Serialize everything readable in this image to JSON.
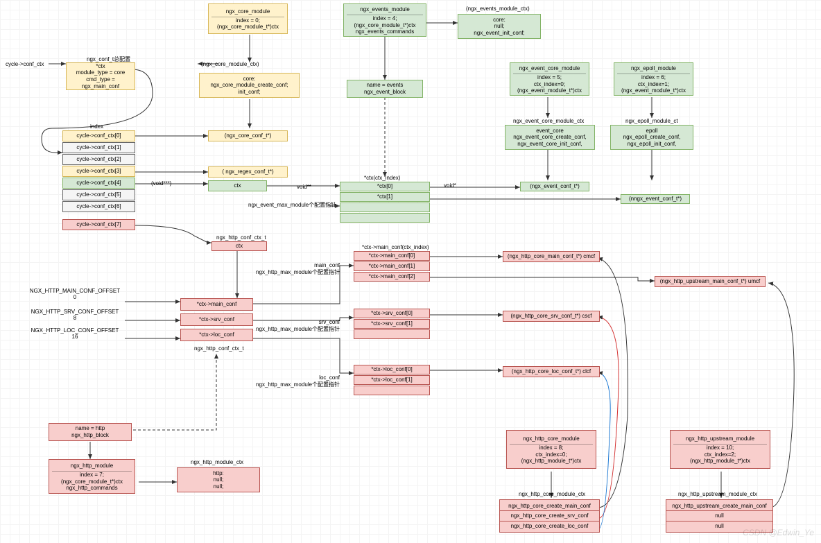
{
  "labels": {
    "conf_t_title": "ngx_conf_t总配置",
    "cycle_conf_ctx": "cycle->conf_ctx",
    "index_label": "index",
    "void_astast": "void**",
    "void_ast": "void*",
    "voidptr3": "(void***)",
    "core_module_ctx": "(ngx_core_module_ctx)",
    "events_module_ctx": "(ngx_events_module_ctx)",
    "event_core_module_ctx": "ngx_event_core_module_ctx",
    "epoll_module_ct": "ngx_epoll_module_ct",
    "ctx_ctx_index": "*ctx(ctx_index)",
    "event_max": "ngx_event_max_module个配置指针",
    "http_conf_ctx_t_top": "ngx_http_conf_ctx_t",
    "http_conf_ctx_t_bot": "ngx_http_conf_ctx_t",
    "main_conf_offset": "NGX_HTTP_MAIN_CONF_OFFSET\n0",
    "srv_conf_offset": "NGX_HTTP_SRV_CONF_OFFSET\n8",
    "loc_conf_offset": "NGX_HTTP_LOC_CONF_OFFSET\n16",
    "main_conf_lbl": "main_conf\nngx_http_max_module个配置指针",
    "srv_conf_lbl": "srv_conf\nngx_http_max_module个配置指针",
    "loc_conf_lbl": "loc_conf\nngx_http_max_module个配置指针",
    "ctx_main_conf_idx": "*ctx->main_conf(ctx_index)",
    "http_module_ctx": "ngx_http_module_ctx",
    "http_core_module_ctx": "ngx_http_core_module_ctx",
    "http_upstream_module_ctx": "ngx_http_upstream_module_ctx"
  },
  "boxes": {
    "conf_t": {
      "l1": "*ctx",
      "l2": "module_type = core",
      "l3": "cmd_type = ngx_main_conf"
    },
    "core_module": {
      "title": "ngx_core_module",
      "l1": "index = 0;",
      "l2": "(ngx_core_module_t*)ctx"
    },
    "events_module": {
      "title": "ngx_events_module",
      "l1": "index = 4;",
      "l2": "(ngx_core_module_t*)ctx",
      "l3": "ngx_events_commands"
    },
    "events_ctx": {
      "l1": "core:",
      "l2": "null;",
      "l3": "ngx_event_init_conf;"
    },
    "core_mod_ctx": {
      "l1": "core:",
      "l2": "ngx_core_module_create_conf;",
      "l3": "init_conf;"
    },
    "events_block": {
      "l1": "name = events",
      "l2": "ngx_event_block"
    },
    "event_core_module": {
      "title": "ngx_event_core_module",
      "l1": "index = 5;",
      "l2": "ctx_index=0;",
      "l3": "(ngx_event_module_t*)ctx"
    },
    "epoll_module": {
      "title": "ngx_epoll_module",
      "l1": "index = 6;",
      "l2": "ctx_index=1;",
      "l3": "(ngx_event_module_t*)ctx"
    },
    "event_core_ctx": {
      "l1": "event_core",
      "l2": "ngx_event_core_create_conf,",
      "l3": "ngx_event_core_init_conf,"
    },
    "epoll_ctx": {
      "l1": "epoll",
      "l2": "ngx_epoll_create_conf,",
      "l3": "ngx_epoll_init_conf,"
    },
    "core_conf_t": "(ngx_core_conf_t*)",
    "regex_conf_t": "( ngx_regex_conf_t*)",
    "ctx_green": "ctx",
    "ctx0": "*ctx[0]",
    "ctx1": "*ctx[1]",
    "event_conf_t": "(ngx_event_conf_t*)",
    "nngx_event_conf_t": "(nngx_event_conf_t*)",
    "conf_ctx": {
      "0": "cycle->conf_ctx[0]",
      "1": "cycle->conf_ctx[1]",
      "2": "cycle->conf_ctx[2]",
      "3": "cycle->conf_ctx[3]",
      "4": "cycle->conf_ctx[4]",
      "5": "cycle->conf_ctx[5]",
      "6": "cycle->conf_ctx[6]",
      "7": "cycle->conf_ctx[7]"
    },
    "http_ctx": "ctx",
    "ctx_main": "*ctx->main_conf",
    "ctx_srv": "*ctx->srv_conf",
    "ctx_loc": "*ctx->loc_conf",
    "main0": "*ctx->main_conf[0]",
    "main1": "*ctx->main_conf[1]",
    "main2": "*ctx->main_conf[2]",
    "srv0": "*ctx->srv_conf[0]",
    "srv1": "*ctx->srv_conf[1]",
    "loc0": "*ctx->loc_conf[0]",
    "loc1": "*ctx->loc_conf[1]",
    "cmcf": "(ngx_http_core_main_conf_t*) cmcf",
    "umcf": "(ngx_http_upstream_main_conf_t*) umcf",
    "cscf": "(ngx_http_core_srv_conf_t*) cscf",
    "clcf": "(ngx_http_core_loc_conf_t*) clcf",
    "name_http": {
      "l1": "name = http",
      "l2": "ngx_http_block"
    },
    "http_module": {
      "title": "ngx_http_module",
      "l1": "index = 7;",
      "l2": "(ngx_core_module_t*)ctx",
      "l3": "ngx_http_commands"
    },
    "http_mod_ctx_box": {
      "l1": "http:",
      "l2": "null;",
      "l3": "null;"
    },
    "http_core_module": {
      "title": "ngx_http_core_module",
      "l1": "index = 8;",
      "l2": "ctx_index=0;",
      "l3": "(ngx_http_module_t*)ctx"
    },
    "http_upstream_module": {
      "title": "ngx_http_upstream_module",
      "l1": "index = 10;",
      "l2": "ctx_index=2;",
      "l3": "(ngx_http_module_t*)ctx"
    },
    "http_core_ctx": {
      "l1": "ngx_http_core_create_main_conf",
      "l2": "ngx_http_core_create_srv_conf",
      "l3": "ngx_http_core_create_loc_conf"
    },
    "http_upstream_ctx": {
      "l1": "ngx_http_upstream_create_main_conf",
      "l2": "null",
      "l3": "null"
    }
  },
  "watermark": "CSDN @Edwin_Ye"
}
